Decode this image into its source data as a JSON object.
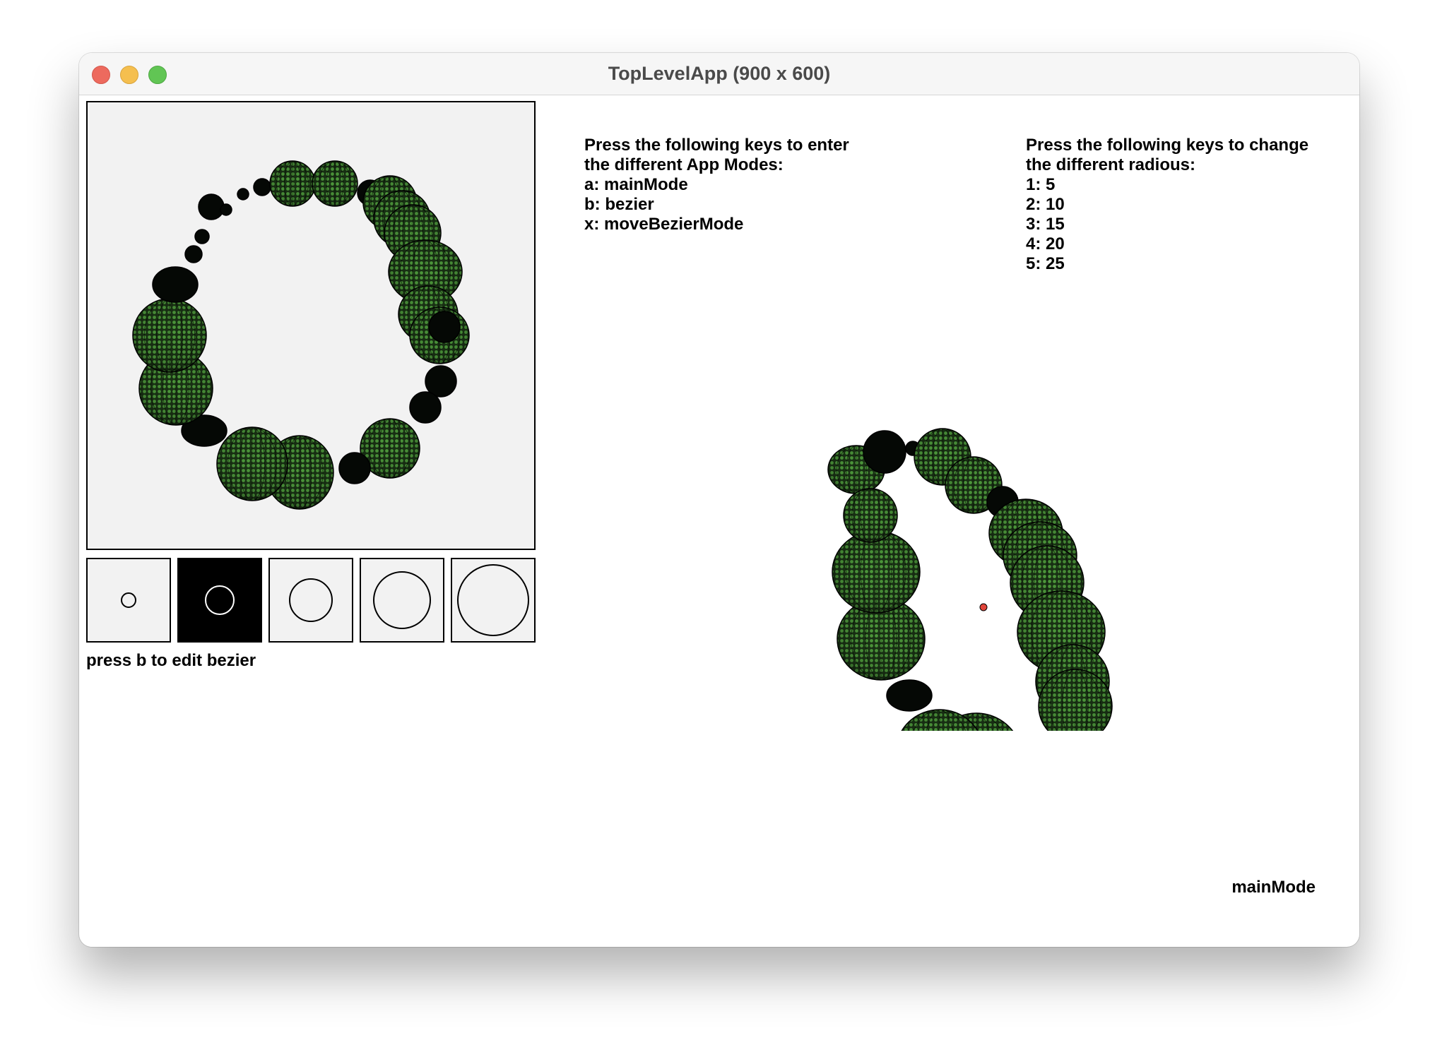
{
  "window": {
    "title": "TopLevelApp (900 x 600)"
  },
  "radius_selector": {
    "selected_index": 1,
    "swatches": [
      {
        "key": "1",
        "radius": 5
      },
      {
        "key": "2",
        "radius": 10
      },
      {
        "key": "3",
        "radius": 15
      },
      {
        "key": "4",
        "radius": 20
      },
      {
        "key": "5",
        "radius": 25
      }
    ]
  },
  "hint_text": "press b to edit bezier",
  "mode_instructions": {
    "title_line1": "Press the following keys to enter",
    "title_line2": "the different App Modes:",
    "items": [
      "a: mainMode",
      "b: bezier",
      "x: moveBezierMode"
    ]
  },
  "radius_instructions": {
    "title_line1": "Press the following keys to change",
    "title_line2": "the different radious:",
    "items": [
      "1: 5",
      "2: 10",
      "3: 15",
      "4: 20",
      "5: 25"
    ]
  },
  "current_mode": "mainMode",
  "colors": {
    "sphere_fill": "#3a6a2e",
    "sphere_dot": "#4e9a3c",
    "sphere_shadow": "#1a3315",
    "outline": "#000000",
    "center_point": "#e0443a",
    "canvas_bg": "#f2f2f2"
  }
}
